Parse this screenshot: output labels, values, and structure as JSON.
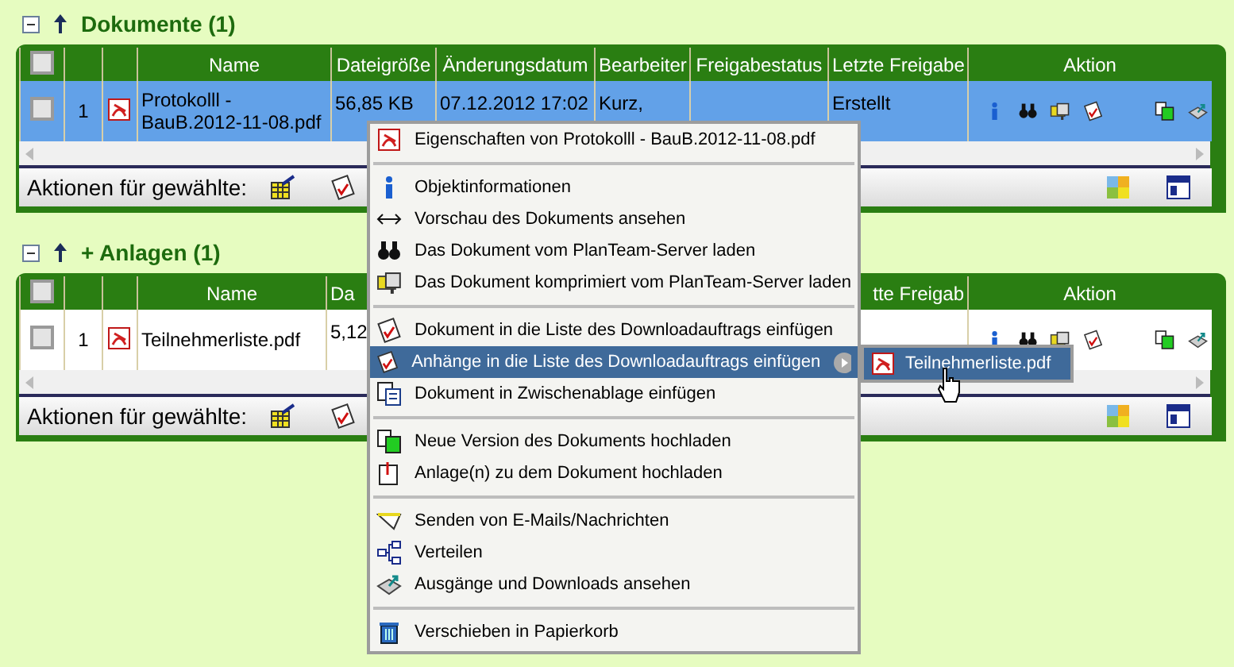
{
  "sections": [
    {
      "title": "Dokumente (1)",
      "expanded": true,
      "header_checked": false,
      "columns": [
        {
          "label": "Name"
        },
        {
          "label": "Dateigröße"
        },
        {
          "label": "Änderungsdatum"
        },
        {
          "label": "Bearbeiter"
        },
        {
          "label": "Freigabestatus"
        },
        {
          "label": "Letzte Freigabe"
        },
        {
          "label": "Aktion"
        }
      ],
      "rows": [
        {
          "selected": true,
          "checked": false,
          "number": "1",
          "cells": [
            "Protokolll - BauB.2012-11-08.pdf",
            "56,85 KB",
            "07.12.2012 17:02",
            "Kurz,",
            "",
            "Erstellt"
          ]
        }
      ],
      "actions_label": "Aktionen für gewählte:"
    },
    {
      "title": "+ Anlagen (1)",
      "expanded": true,
      "header_checked": false,
      "columns": [
        {
          "label": "Name"
        },
        {
          "label": "Da",
          "kind": "tail_cut"
        },
        {},
        {},
        {},
        {
          "label": "tte Freigab",
          "kind": "head_cut"
        },
        {
          "label": "Aktion"
        }
      ],
      "rows": [
        {
          "selected": false,
          "checked": false,
          "number": "1",
          "cells": [
            "Teilnehmerliste.pdf",
            "5,12"
          ]
        }
      ],
      "actions_label": "Aktionen für gewählte:"
    }
  ],
  "context_menu": {
    "groups": [
      [
        {
          "label": "Eigenschaften von Protokolll - BauB.2012-11-08.pdf",
          "selected": false
        }
      ],
      [
        {
          "label": "Objektinformationen",
          "selected": false
        },
        {
          "label": "Vorschau des Dokuments ansehen",
          "selected": false
        },
        {
          "label": "Das Dokument vom PlanTeam-Server laden",
          "selected": false
        },
        {
          "label": "Das Dokument komprimiert vom PlanTeam-Server laden",
          "selected": false
        }
      ],
      [
        {
          "label": "Dokument in die Liste des Downloadauftrags einfügen",
          "selected": false
        },
        {
          "label": "Anhänge in die Liste des Downloadauftrags einfügen",
          "selected": true,
          "submenu": true
        },
        {
          "label": "Dokument in Zwischenablage einfügen",
          "selected": false
        }
      ],
      [
        {
          "label": "Neue Version des Dokuments hochladen",
          "selected": false
        },
        {
          "label": "Anlage(n) zu dem Dokument hochladen",
          "selected": false
        }
      ],
      [
        {
          "label": "Senden von E-Mails/Nachrichten",
          "selected": false
        },
        {
          "label": "Verteilen",
          "selected": false
        },
        {
          "label": "Ausgänge und Downloads ansehen",
          "selected": false
        }
      ],
      [
        {
          "label": "Verschieben in Papierkorb",
          "selected": false
        }
      ]
    ]
  },
  "submenu": {
    "items": [
      {
        "label": "Teilnehmerliste.pdf",
        "selected": true
      }
    ]
  }
}
